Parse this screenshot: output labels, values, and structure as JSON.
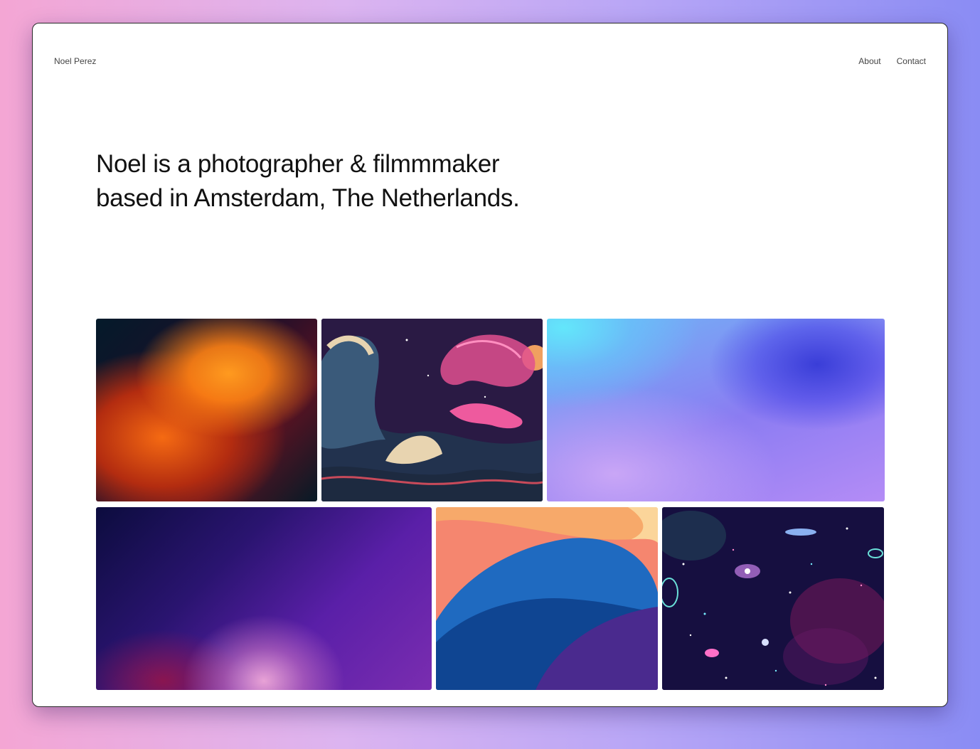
{
  "header": {
    "brand": "Noel Perez",
    "nav": [
      {
        "label": "About"
      },
      {
        "label": "Contact"
      }
    ]
  },
  "hero": {
    "line1": "Noel is a photographer & filmmmaker",
    "line2": "based in Amsterdam, The Netherlands."
  },
  "gallery": [
    {
      "icon": "orange-petal-abstract-image"
    },
    {
      "icon": "japanese-wave-illustration-image"
    },
    {
      "icon": "blue-purple-gradient-image"
    },
    {
      "icon": "purple-gradient-image"
    },
    {
      "icon": "coral-blue-waves-image"
    },
    {
      "icon": "space-galaxy-image"
    }
  ],
  "colors": {
    "background_left": "#f4a6d4",
    "background_right": "#8a8cf4",
    "text": "#111111"
  }
}
